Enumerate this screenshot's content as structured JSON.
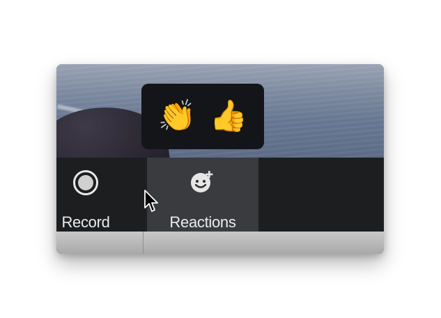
{
  "reactions_popup": {
    "items": [
      {
        "emoji": "👏",
        "icon": "clapping-hands-icon"
      },
      {
        "emoji": "👍",
        "icon": "thumbs-up-icon"
      }
    ]
  },
  "toolbar": {
    "record_label": "Record",
    "reactions_label": "Reactions"
  },
  "icons": {
    "record": "record-icon",
    "reactions": "smile-add-icon",
    "cursor": "pointer-cursor-icon"
  },
  "colors": {
    "toolbar_bg": "#1d1e20",
    "active_tool_bg": "#3a3b3e",
    "popup_bg": "#141518",
    "text": "#ececec"
  }
}
